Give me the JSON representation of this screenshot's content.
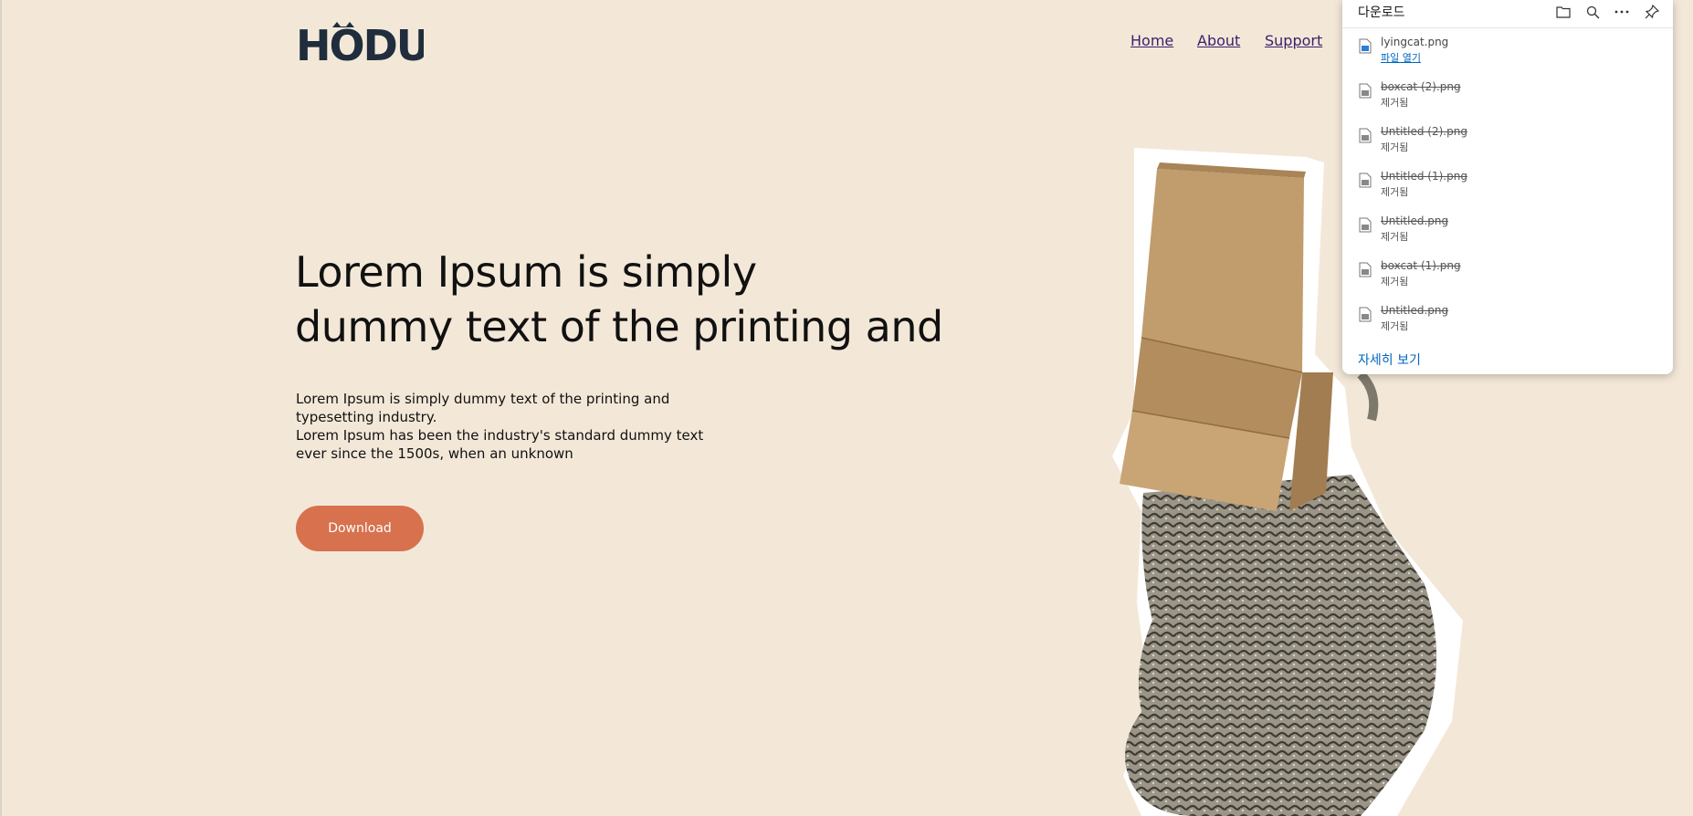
{
  "site": {
    "logo_text": "HODU",
    "nav": [
      {
        "label": "Home"
      },
      {
        "label": "About"
      },
      {
        "label": "Support"
      }
    ]
  },
  "hero": {
    "headline_line1": "Lorem Ipsum is simply",
    "headline_line2": "dummy text of the printing and",
    "desc_lines": [
      "Lorem Ipsum is simply dummy text of the printing and",
      "typesetting industry.",
      "Lorem Ipsum has been the industry's standard dummy text",
      "ever since the 1500s, when an unknown"
    ],
    "button_label": "Download"
  },
  "downloads": {
    "title": "다운로드",
    "tools": [
      "folder-icon",
      "search-icon",
      "more-icon",
      "pin-icon"
    ],
    "items": [
      {
        "name": "lyingcat.png",
        "status": "파일 열기",
        "removed": false
      },
      {
        "name": "boxcat (2).png",
        "status": "제거됨",
        "removed": true
      },
      {
        "name": "Untitled (2).png",
        "status": "제거됨",
        "removed": true
      },
      {
        "name": "Untitled (1).png",
        "status": "제거됨",
        "removed": true
      },
      {
        "name": "Untitled.png",
        "status": "제거됨",
        "removed": true
      },
      {
        "name": "boxcat (1).png",
        "status": "제거됨",
        "removed": true
      },
      {
        "name": "Untitled.png",
        "status": "제거됨",
        "removed": true
      }
    ],
    "more_label": "자세히 보기"
  },
  "colors": {
    "background": "#f3e8d8",
    "button": "#d7714e",
    "nav_link": "#3b1f6b",
    "logo": "#1f2d3d",
    "panel_link": "#0067c0"
  }
}
